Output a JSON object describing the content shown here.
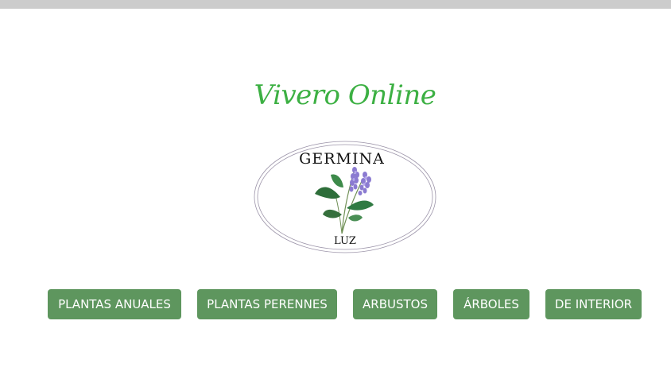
{
  "header": {
    "title": "Vivero Online"
  },
  "logo": {
    "brand_top": "GERMINA",
    "brand_bottom": "LUZ",
    "icon": "lavender-sprig-icon"
  },
  "nav": {
    "items": [
      {
        "label": "PLANTAS ANUALES"
      },
      {
        "label": "PLANTAS PERENNES"
      },
      {
        "label": "ARBUSTOS"
      },
      {
        "label": "ÁRBOLES"
      },
      {
        "label": "DE INTERIOR"
      }
    ]
  },
  "colors": {
    "title": "#3cb043",
    "button_bg": "#5e965e",
    "button_text": "#ffffff",
    "top_bar": "#cccccc"
  }
}
